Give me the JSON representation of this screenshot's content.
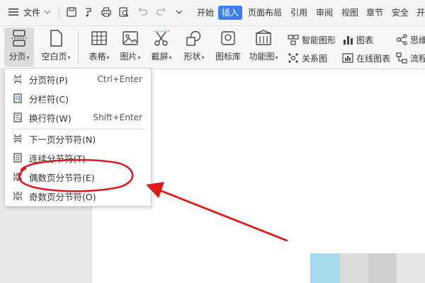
{
  "menubar": {
    "file_label": "文件",
    "tabs": [
      "开始",
      "插入",
      "页面布局",
      "引用",
      "审阅",
      "视图",
      "章节",
      "安全",
      "开"
    ],
    "active_tab": "插入"
  },
  "ribbon": {
    "page_break": "分页",
    "blank_page": "空白页",
    "table": "表格",
    "image": "图片",
    "screenshot": "截屏",
    "shape": "形状",
    "icon_library": "图标库",
    "function_chart": "功能图",
    "smart_shape": "智能图形",
    "chart": "图表",
    "relation_chart": "关系图",
    "online_chart": "在线图表",
    "mind_map": "思维",
    "flow_chart": "流程"
  },
  "dropdown": {
    "items": [
      {
        "label": "分页符(P)",
        "shortcut": "Ctrl+Enter"
      },
      {
        "label": "分栏符(C)",
        "shortcut": ""
      },
      {
        "label": "换行符(W)",
        "shortcut": "Shift+Enter"
      },
      {
        "label": "下一页分节符(N)",
        "shortcut": ""
      },
      {
        "label": "连续分节符(T)",
        "shortcut": ""
      },
      {
        "label": "偶数页分节符(E)",
        "shortcut": ""
      },
      {
        "label": "奇数页分节符(O)",
        "shortcut": ""
      }
    ]
  },
  "colors": {
    "accent": "#3d7ef5",
    "annotation": "#e0191b"
  }
}
